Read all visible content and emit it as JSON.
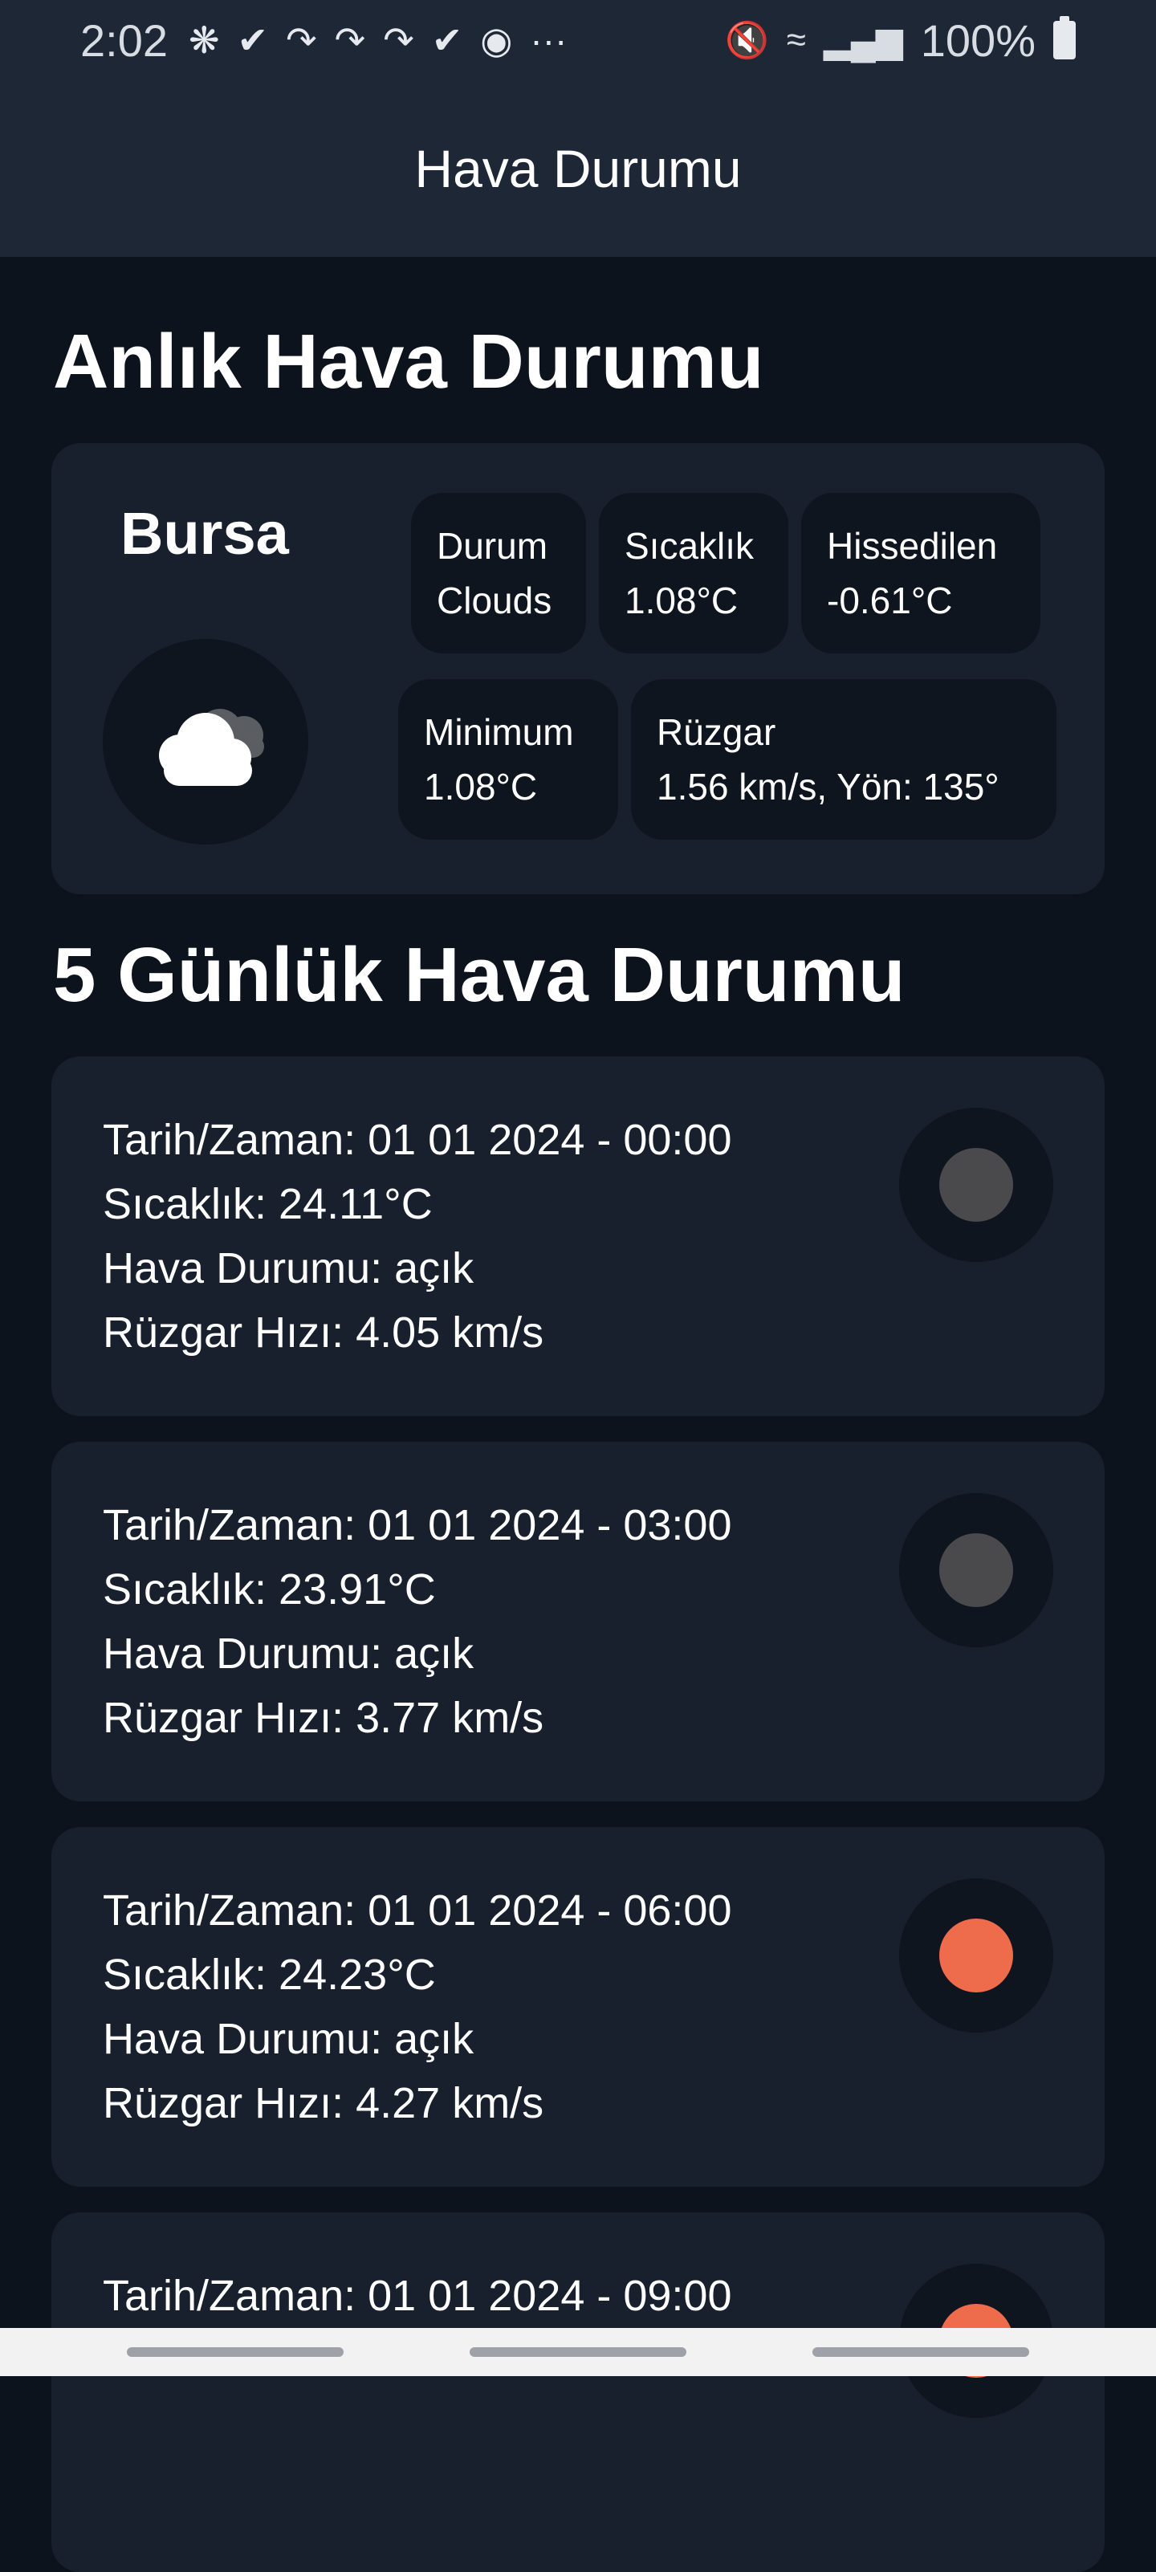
{
  "status_bar": {
    "time": "2:02",
    "notification_icons": [
      "slack-icon",
      "check-icon",
      "arrow-icon",
      "arrow-icon",
      "arrow-icon",
      "check-icon",
      "app-icon"
    ],
    "more": "···",
    "battery": "100%"
  },
  "app_bar": {
    "title": "Hava Durumu"
  },
  "current": {
    "section_title": "Anlık Hava Durumu",
    "city": "Bursa",
    "icon": "cloud-icon",
    "chips": [
      {
        "label": "Durum",
        "value": "Clouds"
      },
      {
        "label": "Sıcaklık",
        "value": "1.08°C"
      },
      {
        "label": "Hissedilen",
        "value": "-0.61°C"
      },
      {
        "label": "Minimum",
        "value": "1.08°C"
      },
      {
        "label": "Rüzgar",
        "value": "1.56 km/s, Yön: 135°"
      }
    ]
  },
  "forecast": {
    "section_title": "5 Günlük Hava Durumu",
    "items": [
      {
        "datetime": "Tarih/Zaman: 01 01 2024 - 00:00",
        "temp": "Sıcaklık: 24.11°C",
        "condition": "Hava Durumu: açık",
        "wind": "Rüzgar Hızı: 4.05 km/s",
        "icon_color": "#4a4a4c"
      },
      {
        "datetime": "Tarih/Zaman: 01 01 2024 - 03:00",
        "temp": "Sıcaklık: 23.91°C",
        "condition": "Hava Durumu: açık",
        "wind": "Rüzgar Hızı: 3.77 km/s",
        "icon_color": "#4a4a4c"
      },
      {
        "datetime": "Tarih/Zaman: 01 01 2024 - 06:00",
        "temp": "Sıcaklık: 24.23°C",
        "condition": "Hava Durumu: açık",
        "wind": "Rüzgar Hızı: 4.27 km/s",
        "icon_color": "#ee6b4b"
      },
      {
        "datetime": "Tarih/Zaman: 01 01 2024 - 09:00",
        "icon_color": "#ee6b4b"
      }
    ]
  }
}
